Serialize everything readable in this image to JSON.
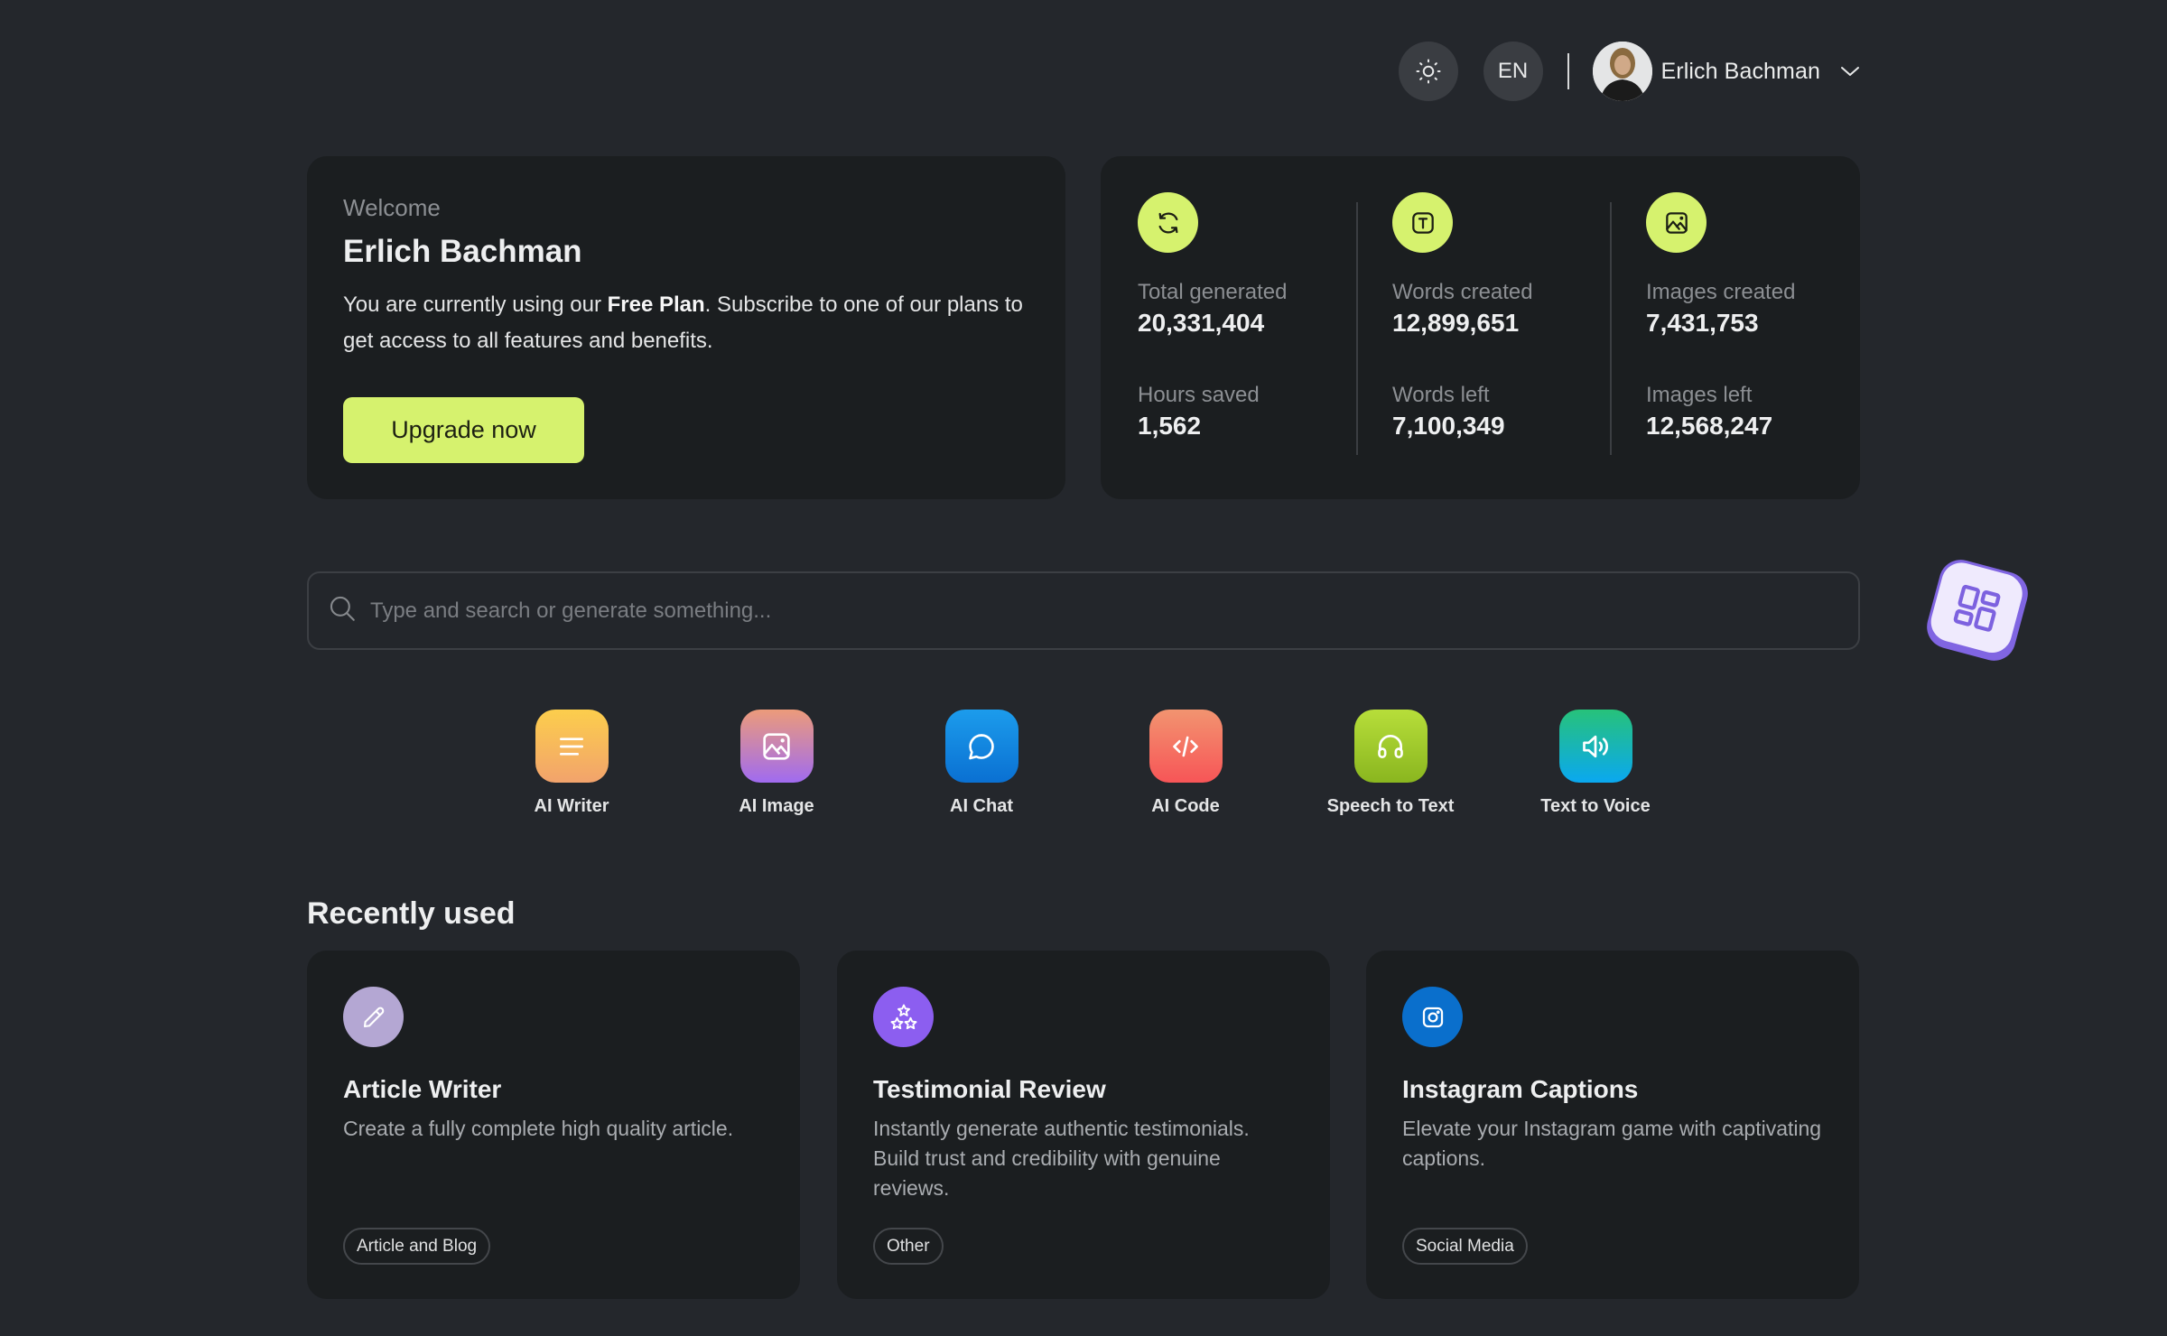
{
  "header": {
    "theme_icon": "sun-icon",
    "language": "EN",
    "user_name": "Erlich Bachman",
    "dropdown_icon": "chevron-down-icon"
  },
  "welcome": {
    "label": "Welcome",
    "name": "Erlich Bachman",
    "text_prefix": "You are currently using our ",
    "plan": "Free Plan",
    "text_suffix": ". Subscribe to one of our plans to get access to all features and benefits.",
    "upgrade_label": "Upgrade now"
  },
  "stats": {
    "accent": "#d6f26e",
    "columns": [
      {
        "icon": "refresh-icon",
        "primary_label": "Total generated",
        "primary_value": "20,331,404",
        "secondary_label": "Hours saved",
        "secondary_value": "1,562"
      },
      {
        "icon": "text-icon",
        "primary_label": "Words created",
        "primary_value": "12,899,651",
        "secondary_label": "Words left",
        "secondary_value": "7,100,349"
      },
      {
        "icon": "image-icon",
        "primary_label": "Images created",
        "primary_value": "7,431,753",
        "secondary_label": "Images left",
        "secondary_value": "12,568,247"
      }
    ]
  },
  "search": {
    "placeholder": "Type and search or generate something...",
    "value": ""
  },
  "floating_widget": {
    "icon": "dashboard-grid-icon"
  },
  "tools": [
    {
      "label": "AI Writer",
      "icon": "lines-icon",
      "colors": [
        "#fcce4c",
        "#f2a36c"
      ]
    },
    {
      "label": "AI Image",
      "icon": "image-icon",
      "colors": [
        "#ec9b7a",
        "#a06bf0"
      ]
    },
    {
      "label": "AI Chat",
      "icon": "chat-bubble-icon",
      "colors": [
        "#1c9cec",
        "#0a70d2"
      ]
    },
    {
      "label": "AI Code",
      "icon": "code-icon",
      "colors": [
        "#f29470",
        "#f75557"
      ]
    },
    {
      "label": "Speech to Text",
      "icon": "headphones-icon",
      "colors": [
        "#b7de3a",
        "#8ab61f"
      ]
    },
    {
      "label": "Text to Voice",
      "icon": "speaker-icon",
      "colors": [
        "#27c27a",
        "#0aa8f0"
      ]
    }
  ],
  "recent": {
    "title": "Recently used",
    "items": [
      {
        "title": "Article Writer",
        "description": "Create a fully complete high quality article.",
        "tag": "Article and Blog",
        "icon": "pencil-icon",
        "color": "#b4a7d3"
      },
      {
        "title": "Testimonial Review",
        "description": "Instantly generate authentic testimonials. Build trust and credibility with genuine reviews.",
        "tag": "Other",
        "icon": "stars-icon",
        "color": "#8c5ef0"
      },
      {
        "title": "Instagram Captions",
        "description": "Elevate your Instagram game with captivating captions.",
        "tag": "Social Media",
        "icon": "instagram-icon",
        "color": "#0a6fcc"
      }
    ]
  }
}
